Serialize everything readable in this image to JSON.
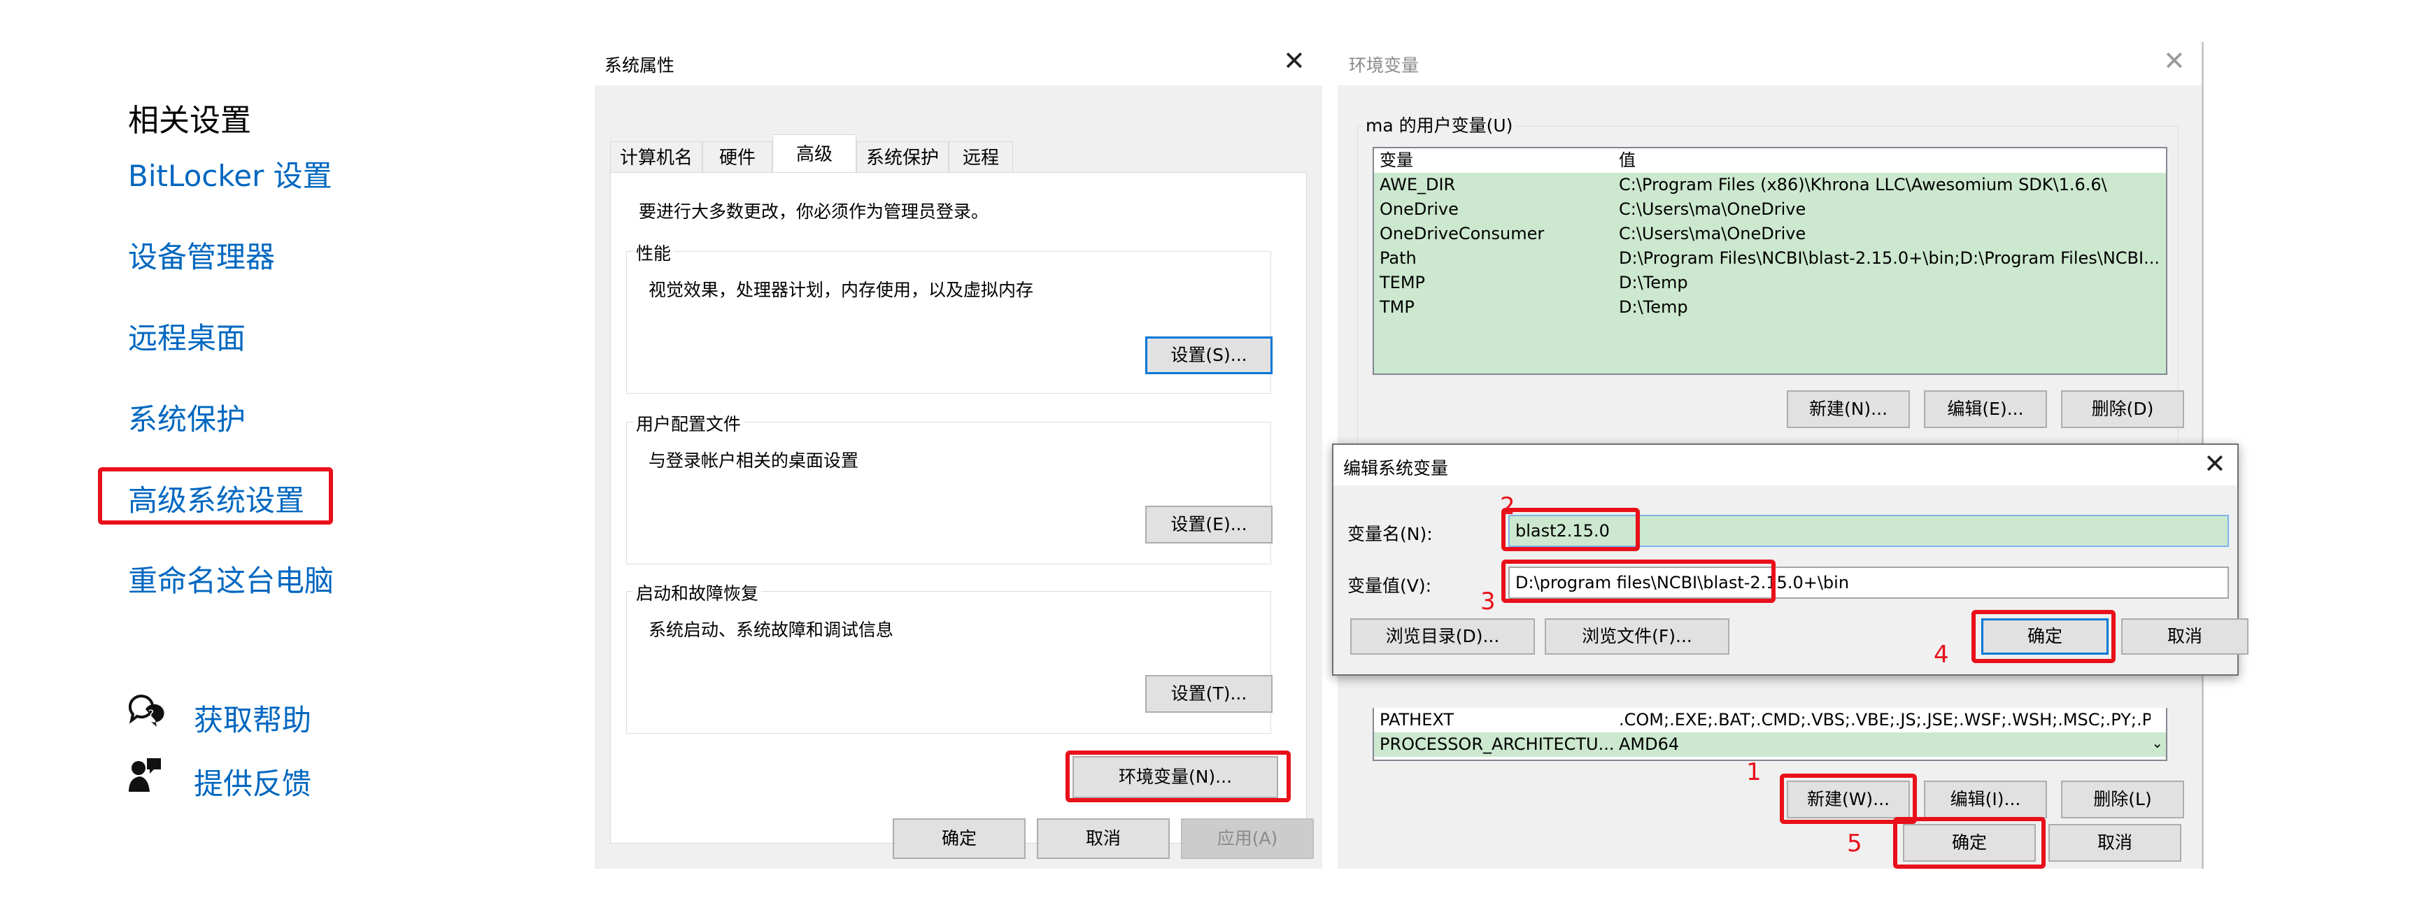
{
  "related_settings": {
    "heading": "相关设置",
    "links": [
      "BitLocker 设置",
      "设备管理器",
      "远程桌面",
      "系统保护",
      "高级系统设置",
      "重命名这台电脑"
    ],
    "help": "获取帮助",
    "feedback": "提供反馈"
  },
  "sys_props": {
    "title": "系统属性",
    "tabs": [
      "计算机名",
      "硬件",
      "高级",
      "系统保护",
      "远程"
    ],
    "admin_note": "要进行大多数更改，你必须作为管理员登录。",
    "performance": {
      "label": "性能",
      "desc": "视觉效果，处理器计划，内存使用，以及虚拟内存",
      "button": "设置(S)..."
    },
    "profiles": {
      "label": "用户配置文件",
      "desc": "与登录帐户相关的桌面设置",
      "button": "设置(E)..."
    },
    "startup": {
      "label": "启动和故障恢复",
      "desc": "系统启动、系统故障和调试信息",
      "button": "设置(T)..."
    },
    "env_button": "环境变量(N)...",
    "ok": "确定",
    "cancel": "取消",
    "apply": "应用(A)"
  },
  "env_vars": {
    "title": "环境变量",
    "user_group_label": "ma 的用户变量(U)",
    "columns": [
      "变量",
      "值"
    ],
    "user_vars": [
      {
        "name": "AWE_DIR",
        "value": "C:\\Program Files (x86)\\Khrona LLC\\Awesomium SDK\\1.6.6\\"
      },
      {
        "name": "OneDrive",
        "value": "C:\\Users\\ma\\OneDrive"
      },
      {
        "name": "OneDriveConsumer",
        "value": "C:\\Users\\ma\\OneDrive"
      },
      {
        "name": "Path",
        "value": "D:\\Program Files\\NCBI\\blast-2.15.0+\\bin;D:\\Program Files\\NCBI..."
      },
      {
        "name": "TEMP",
        "value": "D:\\Temp"
      },
      {
        "name": "TMP",
        "value": "D:\\Temp"
      }
    ],
    "user_buttons": [
      "新建(N)...",
      "编辑(E)...",
      "删除(D)"
    ],
    "sys_vars": [
      {
        "name": "PATHEXT",
        "value": ".COM;.EXE;.BAT;.CMD;.VBS;.VBE;.JS;.JSE;.WSF;.WSH;.MSC;.PY;.PY..."
      },
      {
        "name": "PROCESSOR_ARCHITECTU...",
        "value": "AMD64"
      }
    ],
    "sys_buttons": [
      "新建(W)...",
      "编辑(I)...",
      "删除(L)"
    ],
    "ok": "确定",
    "cancel": "取消"
  },
  "edit_dialog": {
    "title": "编辑系统变量",
    "name_label": "变量名(N):",
    "name_value": "blast2.15.0",
    "value_label": "变量值(V):",
    "value_value": "D:\\program files\\NCBI\\blast-2.15.0+\\bin",
    "browse_dir": "浏览目录(D)...",
    "browse_file": "浏览文件(F)...",
    "ok": "确定",
    "cancel": "取消"
  },
  "annotations": [
    "1",
    "2",
    "3",
    "4",
    "5"
  ],
  "colors": {
    "link": "#0067c0",
    "highlight": "#e8101a",
    "selection": "#cce8cf",
    "default_button": "#0078d7"
  }
}
